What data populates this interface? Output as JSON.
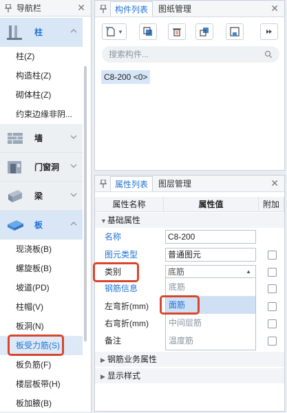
{
  "nav": {
    "title": "导航栏",
    "categories": [
      {
        "label": "柱"
      },
      {
        "label": "墙"
      },
      {
        "label": "门窗洞"
      },
      {
        "label": "梁"
      },
      {
        "label": "板"
      }
    ],
    "column_items": [
      "柱(Z)",
      "构造柱(Z)",
      "砌体柱(Z)",
      "约束边缘非阴..."
    ],
    "slab_items": [
      "现浇板(B)",
      "螺旋板(B)",
      "坡道(PD)",
      "柱帽(V)",
      "板洞(N)",
      "板受力筋(S)",
      "板负筋(F)",
      "楼层板带(H)",
      "板加腋(B)"
    ]
  },
  "component": {
    "tabs": [
      "构件列表",
      "图纸管理"
    ],
    "search_placeholder": "搜索构件...",
    "item": "C8-200 <0>"
  },
  "property": {
    "tabs": [
      "属性列表",
      "图层管理"
    ],
    "headers": [
      "属性名称",
      "属性值",
      "附加"
    ],
    "group_basic": "基础属性",
    "rows": [
      {
        "name": "名称",
        "value": "C8-200"
      },
      {
        "name": "图元类型",
        "value": "普通图元"
      },
      {
        "name": "类别",
        "value": "底筋"
      },
      {
        "name": "钢筋信息",
        "value": ""
      },
      {
        "name": "左弯折(mm)",
        "value": ""
      },
      {
        "name": "右弯折(mm)",
        "value": ""
      },
      {
        "name": "备注",
        "value": ""
      }
    ],
    "dropdown_options": [
      "底筋",
      "面筋",
      "中间层筋",
      "温度筋"
    ],
    "group_business": "钢筋业务属性",
    "group_display": "显示样式"
  },
  "colors": {
    "accent": "#1f73d6",
    "highlight_box": "#d9452b"
  }
}
